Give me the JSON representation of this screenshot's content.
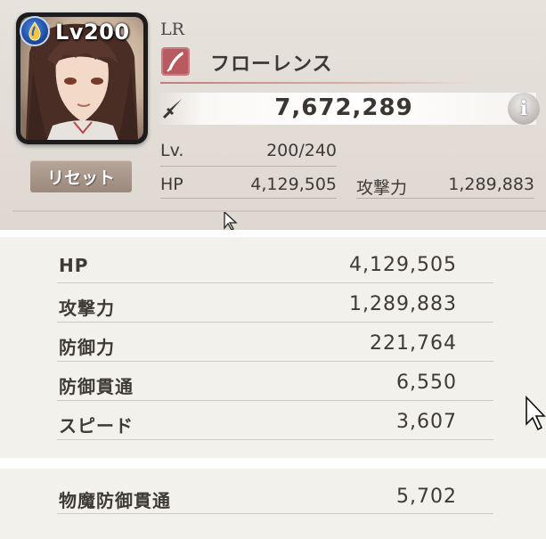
{
  "character": {
    "level_badge": "Lv200",
    "rarity": "LR",
    "name": "フローレンス",
    "power": "7,672,289",
    "reset_label": "リセット",
    "element_icon": "water-drop-icon",
    "role_icon": "feather-quill-icon"
  },
  "summary": {
    "level_label": "Lv.",
    "level_value": "200/240",
    "hp_label": "HP",
    "hp_value": "4,129,505",
    "atk_label": "攻撃力",
    "atk_value": "1,289,883"
  },
  "stats": [
    {
      "label": "HP",
      "value": "4,129,505"
    },
    {
      "label": "攻撃力",
      "value": "1,289,883"
    },
    {
      "label": "防御力",
      "value": "221,764"
    },
    {
      "label": "防御貫通",
      "value": "6,550"
    },
    {
      "label": "スピード",
      "value": "3,607"
    }
  ],
  "extra_stats": [
    {
      "label": "物魔防御貫通",
      "value": "5,702"
    }
  ],
  "colors": {
    "panel_bg": "#e4dfd8",
    "text": "#3e3a36",
    "reset_button": "#a8968b",
    "element_blue": "#2a5fbf",
    "name_underline": "#c07d7a"
  }
}
